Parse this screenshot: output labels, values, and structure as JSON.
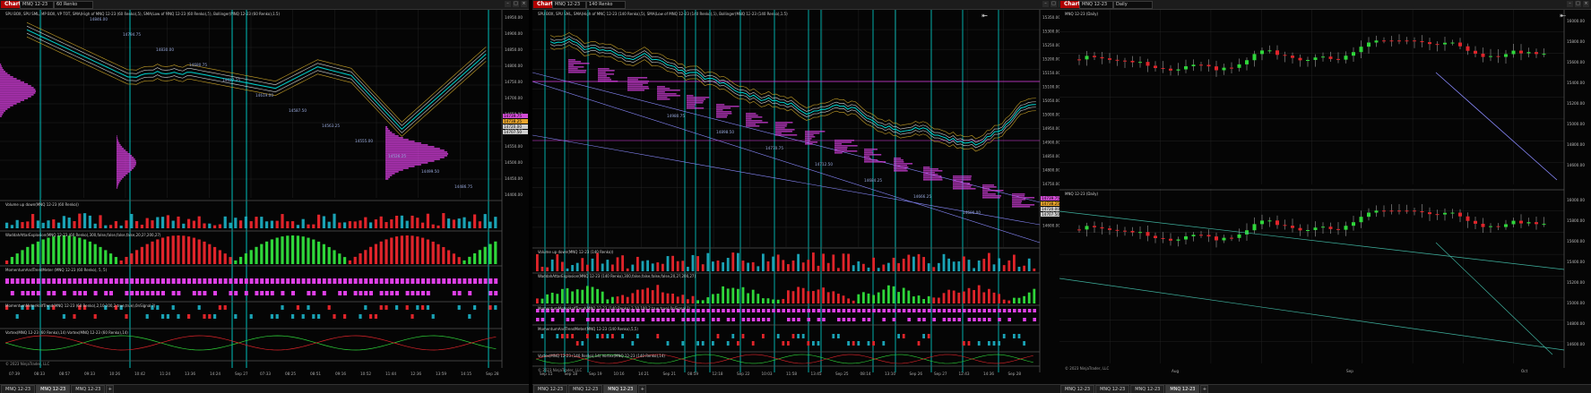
{
  "windows": [
    {
      "chart_label": "Chart",
      "instrument": "MNQ 12-23",
      "period": "60 Renko",
      "indicator_line": "SPU BOX, SPU SML, MP BOX, VP TOT, SMA(High of MNQ 12-23 (60 Renko),5), SMA(Low of MNQ 12-23 (60 Renko),5), Bollinger(MNQ 12-23 (60 Renko),1.5)",
      "panels": [
        "Volume up down(MNQ 12-23 (60 Renko))",
        "WaddahAttarExplosion(MNQ 12-23 (60 Renko),300,false,false,false,false,20,2?,200,27)",
        "MomentumAndTrendMeter (MNQ 12-23 (60 Renko), 5, 5)",
        "MomentumMeterHalfTrend(MNQ 12-23 (60 Renko),2,10,100,2,true,true),0nSignal,?)",
        "Vortex(MNQ 12-23 (60 Renko),14) Vortex(MNQ 12-23 (60 Renko),14)"
      ],
      "copyright": "© 2023 NinjaTrader, LLC",
      "tabs": [
        "MNQ 12-23",
        "MNQ 12-23",
        "MNQ 12-23"
      ],
      "active_tab": 1,
      "tab_add": "+",
      "price_labels": [
        "14950.00",
        "14900.00",
        "14850.00",
        "14800.00",
        "14750.00",
        "14700.00",
        "14650.00",
        "14600.00",
        "14550.00",
        "14500.00",
        "14450.00",
        "14400.00"
      ],
      "time_labels": [
        "07:39",
        "08:33",
        "08:57",
        "09:33",
        "10:26",
        "10:42",
        "11:24",
        "13:36",
        "14:24",
        "Sep 27",
        "07:33",
        "08:25",
        "08:51",
        "09:16",
        "10:52",
        "11:44",
        "12:36",
        "13:59",
        "14:15",
        "Sep 28"
      ],
      "price_tags": [
        {
          "text": "14739.75",
          "color": "#d24cd6"
        },
        {
          "text": "14738.25",
          "color": "#e6a32c"
        },
        {
          "text": "14720.00",
          "color": "#cfcfcf"
        },
        {
          "text": "14707.50",
          "color": "#cfcfcf"
        }
      ],
      "level_texts": [
        "14846.00",
        "14794.75",
        "14830.00",
        "14680.75",
        "14627.25",
        "14619.00",
        "14587.50",
        "14563.25",
        "14555.00",
        "14526.25",
        "14499.50",
        "14486.75"
      ]
    },
    {
      "chart_label": "Chart",
      "instrument": "MNQ 12-23",
      "period": "140 Renko",
      "indicator_line": "SPU BOX, SPU SML, SMA(High of MNQ 12-23 (140 Renko),5), SMA(Low of MNQ 12-23 (140 Renko),5), Bollinger(MNQ 12-23 (140 Renko),1.5)",
      "panels": [
        "Volume up down(MNQ 12-23 (140 Renko))",
        "WaddahAttarExplosion(MNQ 12-23 (140 Renko),300,false,false,false,false,20,2?,200,27)",
        "MomentumMeterHalfTrend(MNQ 12-23 (140 Renko),2,10,100,2,true,true),0nSignal,?)",
        "MomentumAndTrendMeter(MNQ 12-23 (140 Renko),5,5)",
        "Vortex(MNQ 12-23 (140 Renko),14) Vortex(MNQ 12-23 (140 Renko),14)"
      ],
      "copyright": "© 2023 NinjaTrader, LLC",
      "tabs": [
        "MNQ 12-23",
        "MNQ 12-23",
        "MNQ 12-23"
      ],
      "active_tab": 2,
      "tab_add": "+",
      "price_labels": [
        "15350.00",
        "15300.00",
        "15250.00",
        "15200.00",
        "15150.00",
        "15100.00",
        "15050.00",
        "15000.00",
        "14950.00",
        "14900.00",
        "14850.00",
        "14800.00",
        "14750.00",
        "14700.00",
        "14650.00",
        "14600.00"
      ],
      "time_labels": [
        "Sep 15",
        "Sep 18",
        "Sep 19",
        "10:16",
        "14:21",
        "Sep 21",
        "08:59",
        "12:18",
        "Sep 22",
        "10:03",
        "11:58",
        "13:45",
        "Sep 25",
        "08:14",
        "13:10",
        "Sep 26",
        "Sep 27",
        "12:43",
        "14:36",
        "Sep 28"
      ],
      "price_tags": [
        {
          "text": "14739.75",
          "color": "#d24cd6"
        },
        {
          "text": "14738.25",
          "color": "#e6a32c"
        },
        {
          "text": "14720.00",
          "color": "#cfcfcf"
        },
        {
          "text": "14707.50",
          "color": "#cfcfcf"
        }
      ],
      "level_texts": [
        "14980.75",
        "14898.50",
        "14770.75",
        "14712.50",
        "14684.25",
        "14666.25",
        "14600.00"
      ]
    },
    {
      "chart_label": "Chart",
      "instrument": "MNQ 12-23",
      "period": "Daily",
      "panels_top": "MNQ 12-23 (Daily)",
      "panels_bottom": "MNQ 12-23 (Daily)",
      "copyright": "© 2023 NinjaTrader, LLC",
      "tabs": [
        "MNQ 12-23",
        "MNQ 12-23",
        "MNQ 12-23",
        "MNQ 12-23"
      ],
      "active_tab": 3,
      "tab_add": "+",
      "price_labels": [
        "16000.00",
        "15800.00",
        "15600.00",
        "15400.00",
        "15200.00",
        "15000.00",
        "14800.00",
        "14600.00"
      ],
      "time_labels": [
        "Aug",
        "Sep",
        "Oct"
      ]
    }
  ],
  "colors": {
    "up": "#2fd63a",
    "down": "#e0242a",
    "cyan": "#00d5d0",
    "magenta": "#e040e8",
    "volcyan": "#1aa3b5",
    "grid": "#222"
  }
}
